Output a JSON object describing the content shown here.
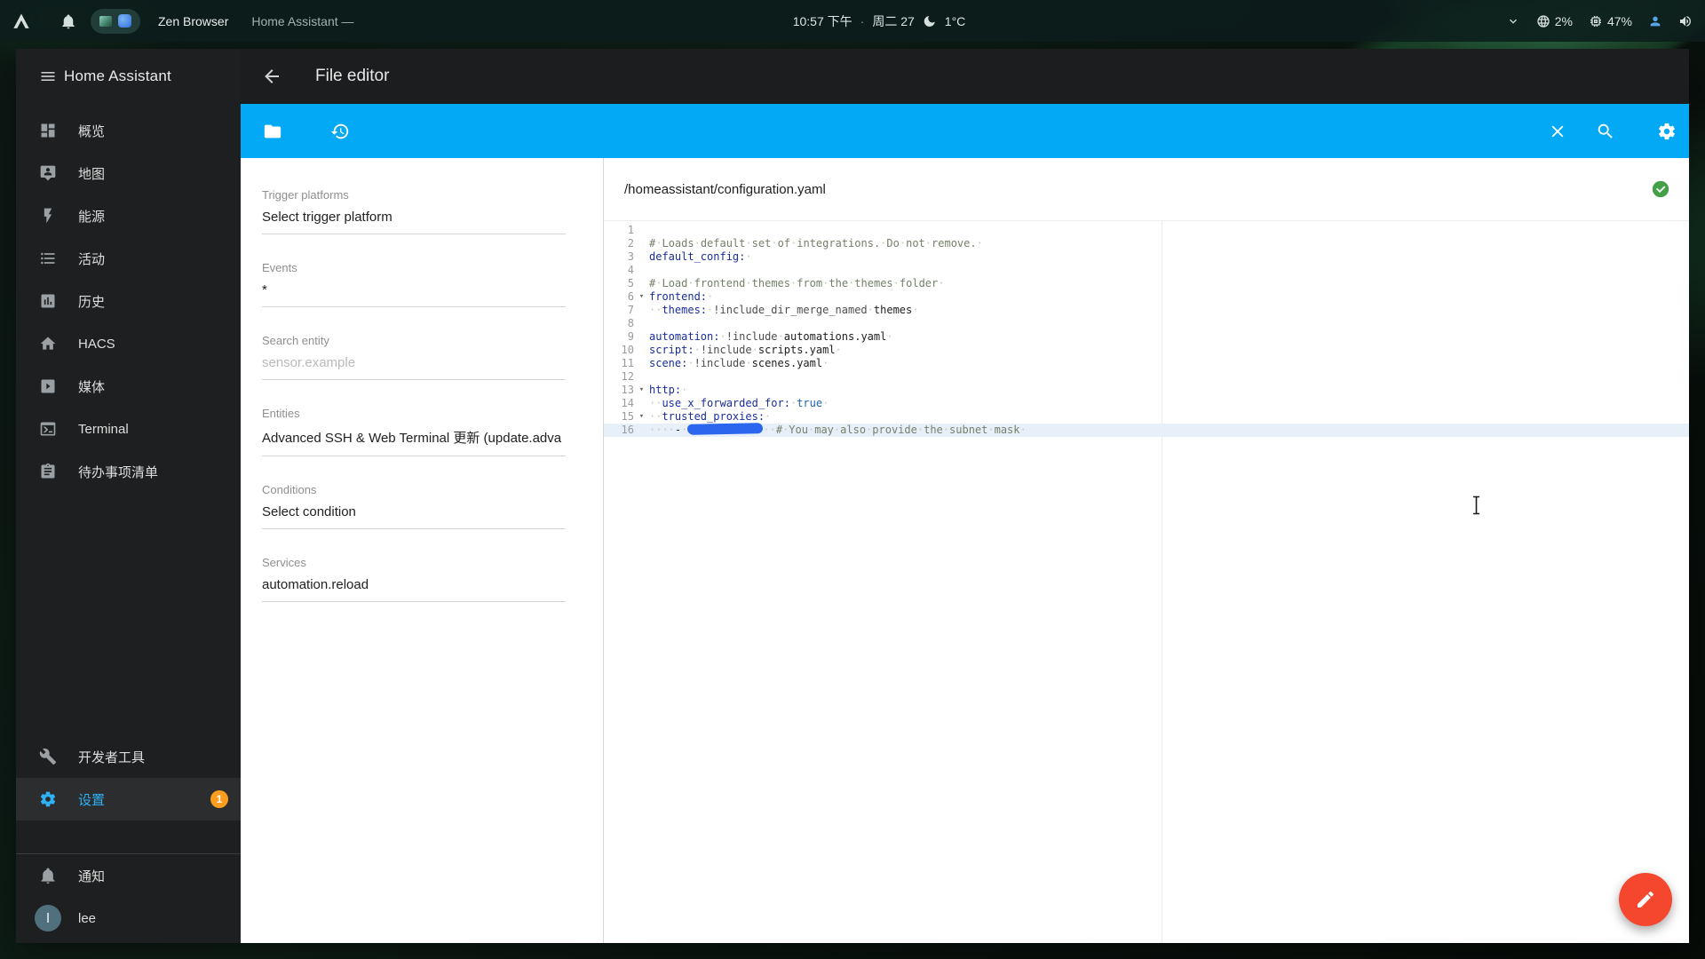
{
  "topbar": {
    "app_name": "Zen Browser",
    "window_title": "Home Assistant —",
    "clock_time": "10:57 下午",
    "clock_separator": "·",
    "clock_date": "周二 27",
    "temperature": "1°C",
    "cpu_usage": "2%",
    "memory_usage": "47%"
  },
  "sidebar": {
    "title": "Home Assistant",
    "items": [
      {
        "name": "overview",
        "icon": "view-dashboard",
        "label": "概览"
      },
      {
        "name": "map",
        "icon": "tooltip-account",
        "label": "地图"
      },
      {
        "name": "energy",
        "icon": "flash",
        "label": "能源"
      },
      {
        "name": "logbook",
        "icon": "format-list-bulleted",
        "label": "活动"
      },
      {
        "name": "history",
        "icon": "chart-box",
        "label": "历史"
      },
      {
        "name": "hacs",
        "icon": "home",
        "label": "HACS"
      },
      {
        "name": "media",
        "icon": "play-box",
        "label": "媒体"
      },
      {
        "name": "terminal",
        "icon": "console",
        "label": "Terminal"
      },
      {
        "name": "todo",
        "icon": "clipboard-text",
        "label": "待办事项清单"
      }
    ],
    "bottom_items": [
      {
        "name": "developer-tools",
        "icon": "wrench",
        "label": "开发者工具",
        "active": false
      },
      {
        "name": "settings",
        "icon": "cog",
        "label": "设置",
        "active": true,
        "badge": "1"
      }
    ],
    "notifications_label": "通知",
    "profile": {
      "name": "lee",
      "avatar_letter": "l"
    }
  },
  "header": {
    "title": "File editor"
  },
  "form": {
    "fields": [
      {
        "name": "trigger-platforms",
        "label": "Trigger platforms",
        "type": "select",
        "value": "Select trigger platform"
      },
      {
        "name": "events",
        "label": "Events",
        "type": "select",
        "value": "*"
      },
      {
        "name": "search-entity",
        "label": "Search entity",
        "type": "input",
        "value": "",
        "placeholder": "sensor.example"
      },
      {
        "name": "entities",
        "label": "Entities",
        "type": "select",
        "value": "Advanced SSH & Web Terminal 更新 (update.adva ..."
      },
      {
        "name": "conditions",
        "label": "Conditions",
        "type": "select",
        "value": "Select condition"
      },
      {
        "name": "services",
        "label": "Services",
        "type": "select",
        "value": "automation.reload"
      }
    ]
  },
  "editor": {
    "file_path": "/homeassistant/configuration.yaml",
    "lines": [
      {
        "num": 1,
        "segments": []
      },
      {
        "num": 2,
        "segments": [
          {
            "t": "# Loads default set of integrations. Do not remove. ",
            "c": "comment"
          }
        ]
      },
      {
        "num": 3,
        "segments": [
          {
            "t": "default_config:",
            "c": "key"
          },
          {
            "t": " ",
            "c": "plain"
          }
        ]
      },
      {
        "num": 4,
        "segments": []
      },
      {
        "num": 5,
        "segments": [
          {
            "t": "# Load frontend themes from the themes folder ",
            "c": "comment"
          }
        ]
      },
      {
        "num": 6,
        "fold": true,
        "segments": [
          {
            "t": "frontend:",
            "c": "key"
          },
          {
            "t": " ",
            "c": "plain"
          }
        ]
      },
      {
        "num": 7,
        "segments": [
          {
            "t": "  ",
            "c": "plain"
          },
          {
            "t": "themes:",
            "c": "key"
          },
          {
            "t": " ",
            "c": "plain"
          },
          {
            "t": "!include_dir_merge_named",
            "c": "meta"
          },
          {
            "t": " themes ",
            "c": "plain"
          }
        ]
      },
      {
        "num": 8,
        "segments": []
      },
      {
        "num": 9,
        "segments": [
          {
            "t": "automation:",
            "c": "key"
          },
          {
            "t": " ",
            "c": "plain"
          },
          {
            "t": "!include",
            "c": "meta"
          },
          {
            "t": " automations.yaml ",
            "c": "plain"
          }
        ]
      },
      {
        "num": 10,
        "segments": [
          {
            "t": "script:",
            "c": "key"
          },
          {
            "t": " ",
            "c": "plain"
          },
          {
            "t": "!include",
            "c": "meta"
          },
          {
            "t": " scripts.yaml ",
            "c": "plain"
          }
        ]
      },
      {
        "num": 11,
        "segments": [
          {
            "t": "scene:",
            "c": "key"
          },
          {
            "t": " ",
            "c": "plain"
          },
          {
            "t": "!include",
            "c": "meta"
          },
          {
            "t": " scenes.yaml ",
            "c": "plain"
          }
        ]
      },
      {
        "num": 12,
        "segments": []
      },
      {
        "num": 13,
        "fold": true,
        "segments": [
          {
            "t": "http:",
            "c": "key"
          },
          {
            "t": " ",
            "c": "plain"
          }
        ]
      },
      {
        "num": 14,
        "segments": [
          {
            "t": "  ",
            "c": "plain"
          },
          {
            "t": "use_x_forwarded_for:",
            "c": "key"
          },
          {
            "t": " ",
            "c": "plain"
          },
          {
            "t": "true",
            "c": "atom"
          },
          {
            "t": " ",
            "c": "plain"
          }
        ]
      },
      {
        "num": 15,
        "fold": true,
        "segments": [
          {
            "t": "  ",
            "c": "plain"
          },
          {
            "t": "trusted_proxies:",
            "c": "key"
          },
          {
            "t": " ",
            "c": "plain"
          }
        ]
      },
      {
        "num": 16,
        "active": true,
        "segments": [
          {
            "t": "    - ",
            "c": "plain"
          },
          {
            "redaction": true
          },
          {
            "t": "  ",
            "c": "plain"
          },
          {
            "t": "# You may also provide the subnet mask ",
            "c": "comment"
          }
        ]
      }
    ]
  },
  "colors": {
    "toolbar": "#03a9f4",
    "accent": "#2fb1f5",
    "fab": "#f4472e",
    "saved": "#43a047",
    "badge": "#fa9d1e",
    "redaction": "#2d66ee"
  }
}
